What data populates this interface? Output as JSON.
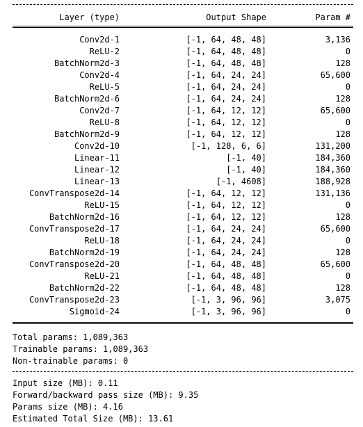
{
  "headers": {
    "layer": "Layer (type)",
    "shape": "Output Shape",
    "params": "Param #"
  },
  "rows": [
    {
      "layer": "Conv2d-1",
      "shape": "[-1, 64, 48, 48]",
      "params": "3,136"
    },
    {
      "layer": "ReLU-2",
      "shape": "[-1, 64, 48, 48]",
      "params": "0"
    },
    {
      "layer": "BatchNorm2d-3",
      "shape": "[-1, 64, 48, 48]",
      "params": "128"
    },
    {
      "layer": "Conv2d-4",
      "shape": "[-1, 64, 24, 24]",
      "params": "65,600"
    },
    {
      "layer": "ReLU-5",
      "shape": "[-1, 64, 24, 24]",
      "params": "0"
    },
    {
      "layer": "BatchNorm2d-6",
      "shape": "[-1, 64, 24, 24]",
      "params": "128"
    },
    {
      "layer": "Conv2d-7",
      "shape": "[-1, 64, 12, 12]",
      "params": "65,600"
    },
    {
      "layer": "ReLU-8",
      "shape": "[-1, 64, 12, 12]",
      "params": "0"
    },
    {
      "layer": "BatchNorm2d-9",
      "shape": "[-1, 64, 12, 12]",
      "params": "128"
    },
    {
      "layer": "Conv2d-10",
      "shape": "[-1, 128, 6, 6]",
      "params": "131,200"
    },
    {
      "layer": "Linear-11",
      "shape": "[-1, 40]",
      "params": "184,360"
    },
    {
      "layer": "Linear-12",
      "shape": "[-1, 40]",
      "params": "184,360"
    },
    {
      "layer": "Linear-13",
      "shape": "[-1, 4608]",
      "params": "188,928"
    },
    {
      "layer": "ConvTranspose2d-14",
      "shape": "[-1, 64, 12, 12]",
      "params": "131,136"
    },
    {
      "layer": "ReLU-15",
      "shape": "[-1, 64, 12, 12]",
      "params": "0"
    },
    {
      "layer": "BatchNorm2d-16",
      "shape": "[-1, 64, 12, 12]",
      "params": "128"
    },
    {
      "layer": "ConvTranspose2d-17",
      "shape": "[-1, 64, 24, 24]",
      "params": "65,600"
    },
    {
      "layer": "ReLU-18",
      "shape": "[-1, 64, 24, 24]",
      "params": "0"
    },
    {
      "layer": "BatchNorm2d-19",
      "shape": "[-1, 64, 24, 24]",
      "params": "128"
    },
    {
      "layer": "ConvTranspose2d-20",
      "shape": "[-1, 64, 48, 48]",
      "params": "65,600"
    },
    {
      "layer": "ReLU-21",
      "shape": "[-1, 64, 48, 48]",
      "params": "0"
    },
    {
      "layer": "BatchNorm2d-22",
      "shape": "[-1, 64, 48, 48]",
      "params": "128"
    },
    {
      "layer": "ConvTranspose2d-23",
      "shape": "[-1, 3, 96, 96]",
      "params": "3,075"
    },
    {
      "layer": "Sigmoid-24",
      "shape": "[-1, 3, 96, 96]",
      "params": "0"
    }
  ],
  "params_summary": {
    "total": "Total params: 1,089,363",
    "trainable": "Trainable params: 1,089,363",
    "non_trainable": "Non-trainable params: 0"
  },
  "size_summary": {
    "input": "Input size (MB): 0.11",
    "forward_backward": "Forward/backward pass size (MB): 9.35",
    "params": "Params size (MB): 4.16",
    "total": "Estimated Total Size (MB): 13.61"
  }
}
